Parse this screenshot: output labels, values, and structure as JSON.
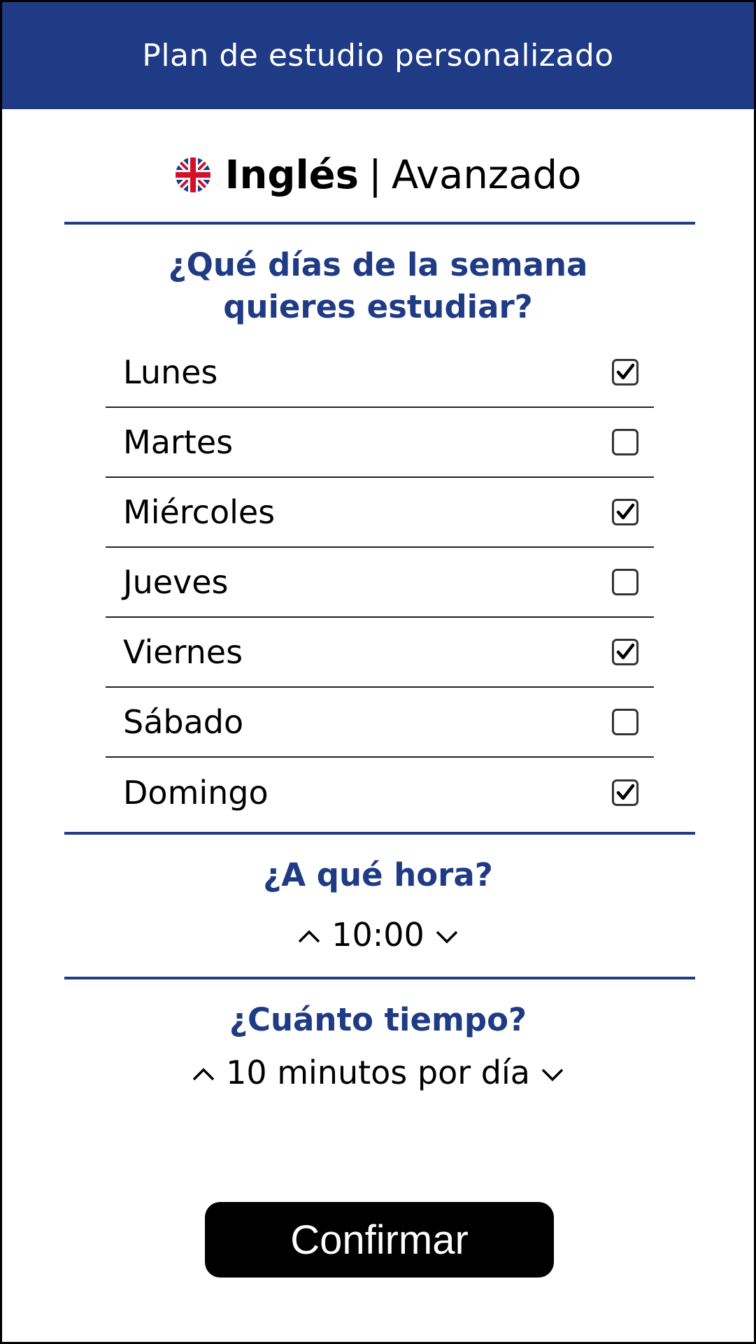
{
  "header": {
    "title": "Plan de estudio personalizado",
    "background_color": "#1f3b85"
  },
  "language": {
    "flag_icon": "uk-flag-icon",
    "name": "Inglés",
    "separator": "|",
    "level": "Avanzado"
  },
  "days_section": {
    "question_line1": "¿Qué días de la semana",
    "question_line2": "quieres estudiar?",
    "days": [
      {
        "label": "Lunes",
        "checked": true
      },
      {
        "label": "Martes",
        "checked": false
      },
      {
        "label": "Miércoles",
        "checked": true
      },
      {
        "label": "Jueves",
        "checked": false
      },
      {
        "label": "Viernes",
        "checked": true
      },
      {
        "label": "Sábado",
        "checked": false
      },
      {
        "label": "Domingo",
        "checked": true
      }
    ]
  },
  "time_section": {
    "question": "¿A qué hora?",
    "value": "10:00",
    "up_icon": "chevron-up-icon",
    "down_icon": "chevron-down-icon"
  },
  "duration_section": {
    "question": "¿Cuánto tiempo?",
    "value": "10 minutos por día",
    "up_icon": "chevron-up-icon",
    "down_icon": "chevron-down-icon"
  },
  "confirm_button": {
    "label": "Confirmar"
  },
  "colors": {
    "accent": "#1f3b85",
    "text": "#000000",
    "button_bg": "#000000",
    "button_text": "#ffffff"
  }
}
